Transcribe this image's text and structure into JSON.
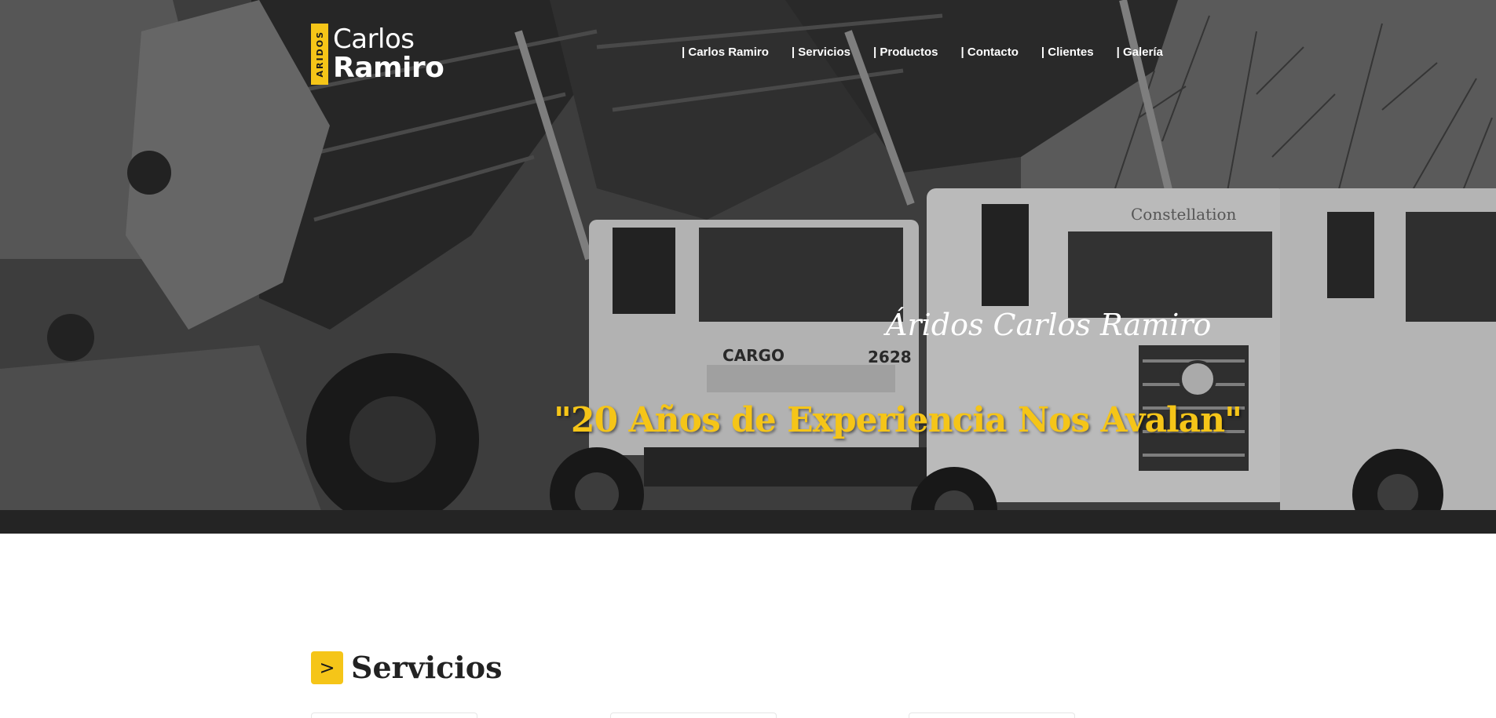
{
  "brand": {
    "badge": "ARIDOS",
    "line1": "Carlos",
    "line2": "Ramiro",
    "accent_color": "#f5c518"
  },
  "nav": {
    "items": [
      {
        "label": "| Carlos Ramiro"
      },
      {
        "label": "| Servicios"
      },
      {
        "label": "| Productos"
      },
      {
        "label": "| Contacto"
      },
      {
        "label": "| Clientes"
      },
      {
        "label": "| Galería"
      }
    ]
  },
  "hero": {
    "subtitle": "Áridos Carlos Ramiro",
    "title": "\"20 Años de Experiencia Nos Avalan\"",
    "image": "trucks-and-excavator-photo"
  },
  "services": {
    "chevron": ">",
    "title": "Servicios"
  }
}
